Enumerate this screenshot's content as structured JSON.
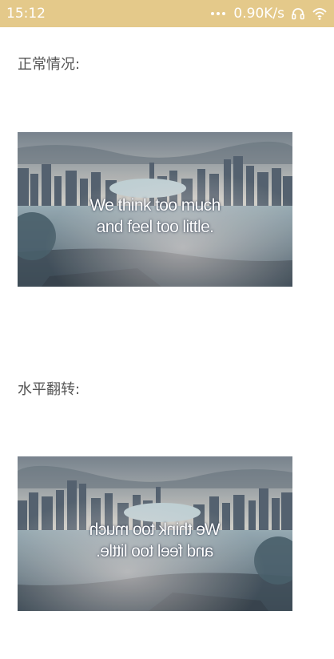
{
  "status_bar": {
    "time": "15:12",
    "network_speed": "0.90K/s",
    "icons": [
      "more-dots-icon",
      "headset-icon",
      "wifi-icon"
    ]
  },
  "sections": [
    {
      "label": "正常情况:",
      "caption_line1": "We think too much",
      "caption_line2": "and feel too little.",
      "mirrored": false
    },
    {
      "label": "水平翻转:",
      "caption_line1": "We think too much",
      "caption_line2": "and feel too little.",
      "mirrored": true
    }
  ],
  "colors": {
    "status_bar_bg": "#e4c98a",
    "label_text": "#555555",
    "page_bg": "#ffffff"
  }
}
